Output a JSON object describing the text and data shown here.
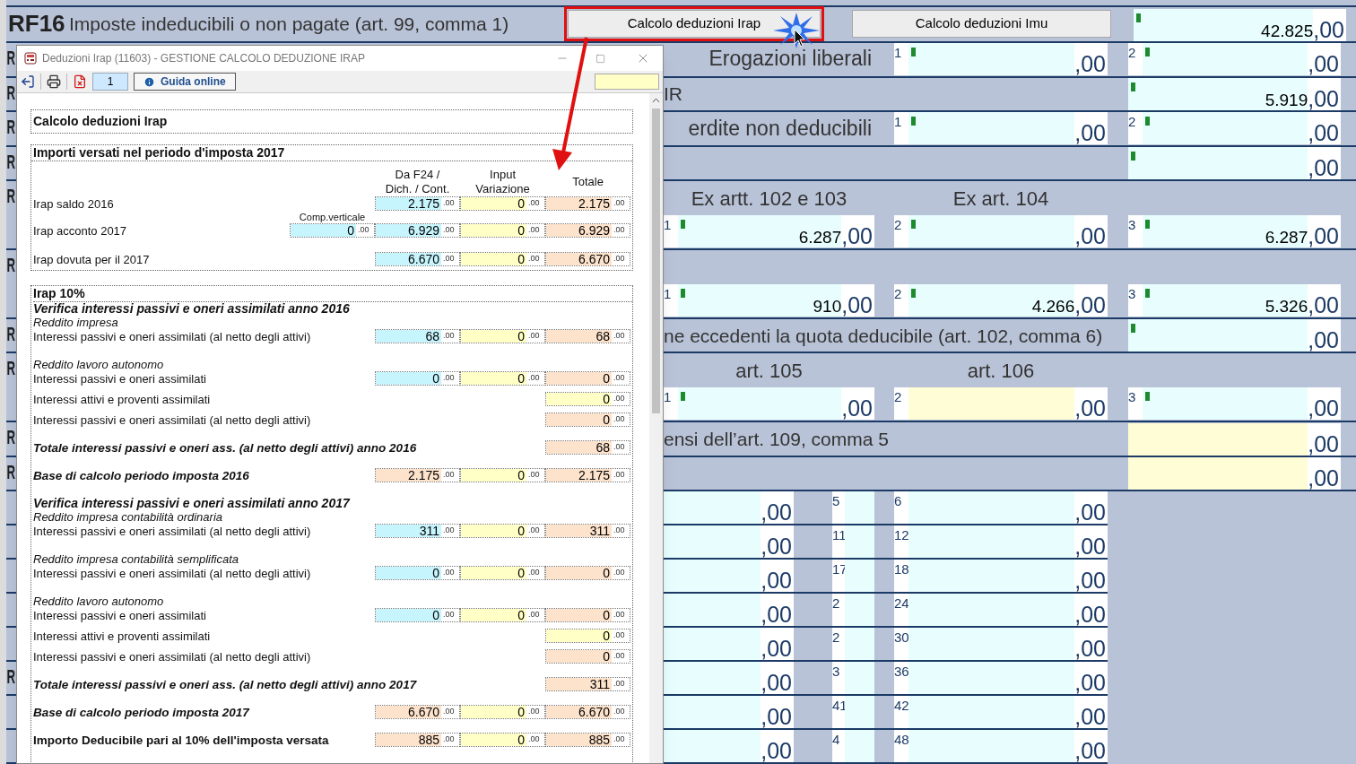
{
  "form": {
    "header": {
      "code": "RF16",
      "title": "Imposte indeducibili o non pagate (art. 99, comma 1)",
      "buttons": [
        {
          "label": "Calcolo deduzioni Irap",
          "highlighted": true
        },
        {
          "label": "Calcolo deduzioni Imu",
          "highlighted": false
        }
      ],
      "field": {
        "value": "42.825",
        "decimals": ",00",
        "color": "#e8fefe",
        "marked": true
      }
    },
    "rows": [
      {
        "kind": "triple",
        "code": "R",
        "label": "Erogazioni liberali",
        "b": {
          "index": "1",
          "decimals": ",00",
          "color": "#e8fefe",
          "marked": true
        },
        "c": {
          "index": "2",
          "decimals": ",00",
          "color": "#e8fefe",
          "marked": true
        }
      },
      {
        "kind": "single",
        "code": "R",
        "label": "IR",
        "c": {
          "value": "5.919",
          "decimals": ",00",
          "color": "#e8fefe",
          "marked": true
        }
      },
      {
        "kind": "triple",
        "code": "R",
        "label": "erdite non deducibili",
        "b": {
          "index": "1",
          "decimals": ",00",
          "color": "#e8fefe",
          "marked": true
        },
        "c": {
          "index": "2",
          "decimals": ",00",
          "color": "#e8fefe",
          "marked": true
        }
      },
      {
        "kind": "single",
        "code": "R",
        "c": {
          "decimals": ",00",
          "color": "#e8fefe",
          "marked": true
        }
      },
      {
        "kind": "triple",
        "code": "R",
        "headers": [
          "Ex artt. 102 e 103",
          "Ex art. 104"
        ],
        "a": {
          "index": "1",
          "value": "6.287",
          "decimals": ",00",
          "color": "#e8fefe",
          "marked": true
        },
        "b": {
          "index": "2",
          "decimals": ",00",
          "color": "#e8fefe",
          "marked": true
        },
        "c": {
          "index": "3",
          "value": "6.287",
          "decimals": ",00",
          "color": "#e8fefe",
          "marked": true
        }
      },
      {
        "kind": "triple",
        "code": "R",
        "a": {
          "index": "1",
          "value": "910",
          "decimals": ",00",
          "color": "#e8fefe",
          "marked": true
        },
        "b": {
          "index": "2",
          "value": "4.266",
          "decimals": ",00",
          "color": "#e8fefe",
          "marked": true
        },
        "c": {
          "index": "3",
          "value": "5.326",
          "decimals": ",00",
          "color": "#e8fefe",
          "marked": true
        }
      },
      {
        "kind": "single",
        "code": "R",
        "label": "ne eccedenti la quota deducibile (art. 102, comma 6)",
        "c": {
          "decimals": ",00",
          "color": "#e8fefe",
          "marked": true
        }
      },
      {
        "kind": "triple",
        "code": "R",
        "headers": [
          "art. 105",
          "art. 106"
        ],
        "a": {
          "index": "1",
          "decimals": ",00",
          "color": "#e8fefe",
          "marked": true
        },
        "b": {
          "index": "2",
          "decimals": ",00",
          "color": "#fffdd6",
          "marked": false
        },
        "c": {
          "index": "3",
          "decimals": ",00",
          "color": "#e8fefe",
          "marked": true
        }
      },
      {
        "kind": "single",
        "code": "R",
        "label": "ensi dell’art. 109, comma 5",
        "c": {
          "decimals": ",00",
          "color": "#fffdd6",
          "marked": false
        }
      },
      {
        "kind": "single",
        "code": "R",
        "c": {
          "decimals": ",00",
          "color": "#fffdd6",
          "marked": false
        }
      },
      {
        "kind": "grid",
        "a": {
          "decimals": ",00",
          "color": "#e8fefe",
          "marked": false
        },
        "mid": "5",
        "b": {
          "index": "6",
          "decimals": ",00",
          "color": "#e8fefe",
          "marked": false
        }
      },
      {
        "kind": "grid",
        "a": {
          "decimals": ",00",
          "color": "#e8fefe",
          "marked": false
        },
        "mid": "11",
        "b": {
          "index": "12",
          "decimals": ",00",
          "color": "#e8fefe",
          "marked": false
        }
      },
      {
        "kind": "grid",
        "a": {
          "decimals": ",00",
          "color": "#e8fefe",
          "marked": false
        },
        "mid": "17",
        "b": {
          "index": "18",
          "decimals": ",00",
          "color": "#e8fefe",
          "marked": false
        }
      },
      {
        "kind": "grid",
        "a": {
          "decimals": ",00",
          "color": "#e8fefe",
          "marked": false
        },
        "mid": "2",
        "b": {
          "index": "24",
          "decimals": ",00",
          "color": "#e8fefe",
          "marked": false
        }
      },
      {
        "kind": "grid",
        "a": {
          "decimals": ",00",
          "color": "#e8fefe",
          "marked": false
        },
        "mid": "2",
        "b": {
          "index": "30",
          "decimals": ",00",
          "color": "#e8fefe",
          "marked": false
        }
      },
      {
        "kind": "grid",
        "code": "R",
        "a": {
          "decimals": ",00",
          "color": "#e8fefe",
          "marked": false
        },
        "mid": "3",
        "b": {
          "index": "36",
          "decimals": ",00",
          "color": "#e8fefe",
          "marked": false
        }
      },
      {
        "kind": "grid",
        "a": {
          "decimals": ",00",
          "color": "#e8fefe",
          "marked": false
        },
        "mid": "41",
        "b": {
          "index": "42",
          "decimals": ",00",
          "color": "#e8fefe",
          "marked": false
        }
      },
      {
        "kind": "grid",
        "a": {
          "decimals": ",00",
          "color": "#e8fefe",
          "marked": false
        },
        "mid": "4",
        "b": {
          "index": "48",
          "decimals": ",00",
          "color": "#e8fefe",
          "marked": false
        }
      }
    ]
  },
  "dialog": {
    "title": "Deduzioni Irap (11603) - GESTIONE CALCOLO DEDUZIONE IRAP",
    "page_number": "1",
    "help_button": "Guida online",
    "heading": "Calcolo deduzioni Irap",
    "payments": {
      "title": "Importi versati nel periodo d'imposta 2017",
      "columns": [
        [
          "Da F24 /",
          "Dich. / Cont."
        ],
        [
          "Input",
          "Variazione"
        ],
        [
          "Totale"
        ]
      ],
      "rows": [
        {
          "label": "Irap saldo 2016",
          "cells": {
            "da_f24": {
              "value": "2.175",
              "decimals": ".00",
              "color": "#c7f5fd"
            },
            "input_variazione": {
              "value": "0",
              "decimals": ".00",
              "color": "#ffffc6"
            },
            "totale": {
              "value": "2.175",
              "decimals": ".00",
              "color": "#fde3cc"
            }
          }
        },
        {
          "label": "Irap acconto 2017",
          "comp_label": "Comp.verticale",
          "cells": {
            "comp_verticale": {
              "value": "0",
              "decimals": ".00",
              "color": "#c7f5fd"
            },
            "da_f24": {
              "value": "6.929",
              "decimals": ".00",
              "color": "#c7f5fd"
            },
            "input_variazione": {
              "value": "0",
              "decimals": ".00",
              "color": "#ffffc6"
            },
            "totale": {
              "value": "6.929",
              "decimals": ".00",
              "color": "#fde3cc"
            }
          }
        },
        {
          "label": "Irap dovuta per il 2017",
          "cells": {
            "da_f24": {
              "value": "6.670",
              "decimals": ".00",
              "color": "#c7f5fd"
            },
            "input_variazione": {
              "value": "0",
              "decimals": ".00",
              "color": "#ffffc6"
            },
            "totale": {
              "value": "6.670",
              "decimals": ".00",
              "color": "#fde3cc"
            }
          }
        }
      ]
    },
    "irap10": {
      "title": "Irap 10%",
      "rows": [
        {
          "kind": "subheading",
          "label": "Verifica interessi passivi e oneri assimilati anno 2016"
        },
        {
          "kind": "group",
          "label": "Reddito impresa"
        },
        {
          "kind": "data",
          "label": "Interessi passivi e oneri assimilati (al netto degli attivi)",
          "cells": {
            "da_f24": {
              "value": "68",
              "decimals": ".00",
              "color": "#c7f5fd"
            },
            "input_variazione": {
              "value": "0",
              "decimals": ".00",
              "color": "#ffffc6"
            },
            "totale": {
              "value": "68",
              "decimals": ".00",
              "color": "#fde3cc"
            }
          }
        },
        {
          "kind": "group",
          "label": "Reddito lavoro autonomo"
        },
        {
          "kind": "data",
          "label": "Interessi passivi e oneri assimilati",
          "cells": {
            "da_f24": {
              "value": "0",
              "decimals": ".00",
              "color": "#c7f5fd"
            },
            "input_variazione": {
              "value": "0",
              "decimals": ".00",
              "color": "#ffffc6"
            },
            "totale": {
              "value": "0",
              "decimals": ".00",
              "color": "#fde3cc"
            }
          }
        },
        {
          "kind": "data",
          "label": "Interessi attivi e proventi assimilati",
          "cells": {
            "totale": {
              "value": "0",
              "decimals": ".00",
              "color": "#ffffc6"
            }
          }
        },
        {
          "kind": "data",
          "label": "Interessi passivi e oneri assimilati (al netto degli attivi)",
          "cells": {
            "totale": {
              "value": "0",
              "decimals": ".00",
              "color": "#fde3cc"
            }
          }
        },
        {
          "kind": "total",
          "label": "Totale interessi passivi e oneri ass. (al netto degli attivi) anno 2016",
          "cells": {
            "totale": {
              "value": "68",
              "decimals": ".00",
              "color": "#fde3cc"
            }
          }
        },
        {
          "kind": "total",
          "label": "Base di calcolo periodo imposta 2016",
          "cells": {
            "da_f24": {
              "value": "2.175",
              "decimals": ".00",
              "color": "#fde3cc"
            },
            "input_variazione": {
              "value": "0",
              "decimals": ".00",
              "color": "#ffffc6"
            },
            "totale": {
              "value": "2.175",
              "decimals": ".00",
              "color": "#fde3cc"
            }
          }
        },
        {
          "kind": "subheading",
          "label": "Verifica interessi passivi e oneri assimilati anno 2017"
        },
        {
          "kind": "group",
          "label": "Reddito impresa contabilità ordinaria"
        },
        {
          "kind": "data",
          "label": "Interessi passivi e oneri assimilati (al netto degli attivi)",
          "cells": {
            "da_f24": {
              "value": "311",
              "decimals": ".00",
              "color": "#c7f5fd"
            },
            "input_variazione": {
              "value": "0",
              "decimals": ".00",
              "color": "#ffffc6"
            },
            "totale": {
              "value": "311",
              "decimals": ".00",
              "color": "#fde3cc"
            }
          }
        },
        {
          "kind": "group",
          "label": "Reddito impresa contabilità semplificata"
        },
        {
          "kind": "data",
          "label": "Interessi passivi e oneri assimilati (al netto degli attivi)",
          "cells": {
            "da_f24": {
              "value": "0",
              "decimals": ".00",
              "color": "#c7f5fd"
            },
            "input_variazione": {
              "value": "0",
              "decimals": ".00",
              "color": "#ffffc6"
            },
            "totale": {
              "value": "0",
              "decimals": ".00",
              "color": "#fde3cc"
            }
          }
        },
        {
          "kind": "group",
          "label": "Reddito lavoro autonomo"
        },
        {
          "kind": "data",
          "label": "Interessi passivi e oneri assimilati",
          "cells": {
            "da_f24": {
              "value": "0",
              "decimals": ".00",
              "color": "#c7f5fd"
            },
            "input_variazione": {
              "value": "0",
              "decimals": ".00",
              "color": "#ffffc6"
            },
            "totale": {
              "value": "0",
              "decimals": ".00",
              "color": "#fde3cc"
            }
          }
        },
        {
          "kind": "data",
          "label": "Interessi attivi e proventi assimilati",
          "cells": {
            "totale": {
              "value": "0",
              "decimals": ".00",
              "color": "#ffffc6"
            }
          }
        },
        {
          "kind": "data",
          "label": "Interessi passivi e oneri assimilati (al netto degli attivi)",
          "cells": {
            "totale": {
              "value": "0",
              "decimals": ".00",
              "color": "#fde3cc"
            }
          }
        },
        {
          "kind": "total",
          "label": "Totale interessi passivi e oneri ass. (al netto degli attivi) anno 2017",
          "cells": {
            "totale": {
              "value": "311",
              "decimals": ".00",
              "color": "#fde3cc"
            }
          }
        },
        {
          "kind": "total",
          "label": "Base di calcolo periodo imposta 2017",
          "cells": {
            "da_f24": {
              "value": "6.670",
              "decimals": ".00",
              "color": "#fde3cc"
            },
            "input_variazione": {
              "value": "0",
              "decimals": ".00",
              "color": "#ffffc6"
            },
            "totale": {
              "value": "6.670",
              "decimals": ".00",
              "color": "#fde3cc"
            }
          }
        },
        {
          "kind": "final",
          "label": "Importo Deducibile pari al 10% dell'imposta versata",
          "cells": {
            "da_f24": {
              "value": "885",
              "decimals": ".00",
              "color": "#fde3cc"
            },
            "input_variazione": {
              "value": "0",
              "decimals": ".00",
              "color": "#ffffc6"
            },
            "totale": {
              "value": "885",
              "decimals": ".00",
              "color": "#fde3cc"
            }
          }
        }
      ]
    }
  }
}
